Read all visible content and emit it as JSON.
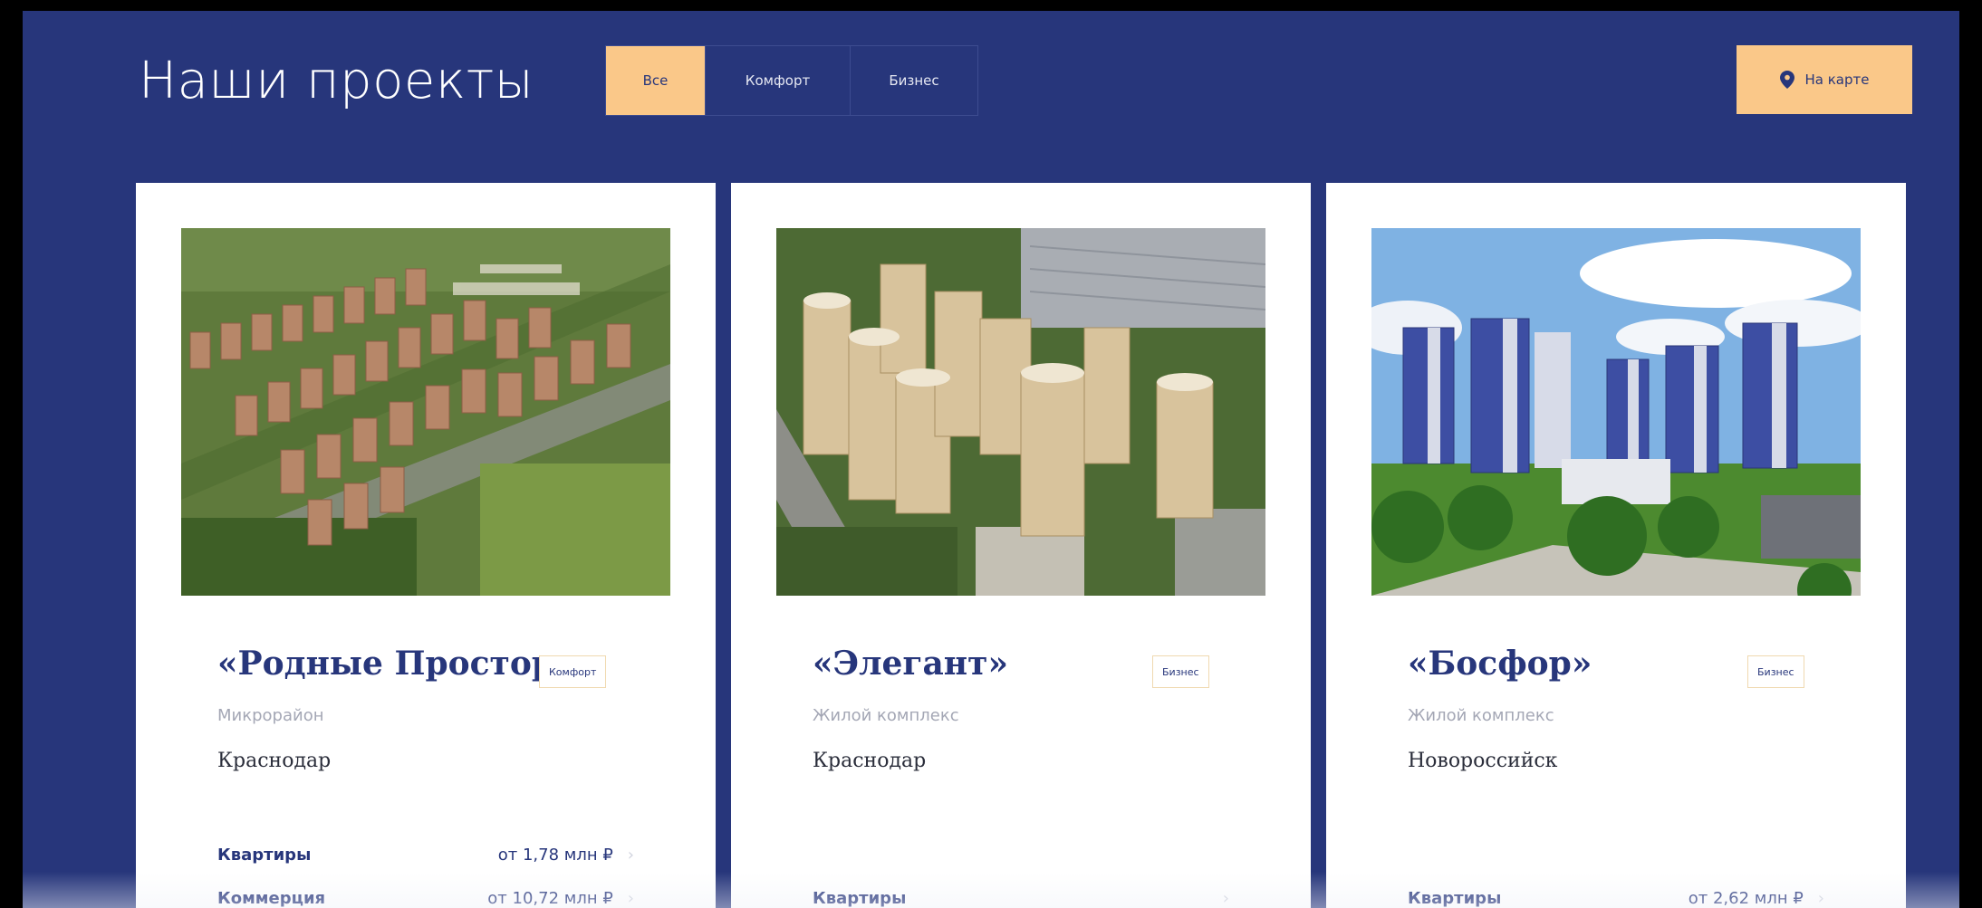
{
  "page": {
    "title": "Наши проекты"
  },
  "filters": {
    "tabs": [
      "Все",
      "Комфорт",
      "Бизнес"
    ],
    "active": "Все"
  },
  "map_button": {
    "label": "На карте",
    "icon": "map-pin-icon"
  },
  "colors": {
    "background": "#27367b",
    "accent": "#fac889",
    "card": "#ffffff",
    "text_primary": "#27367b",
    "text_muted": "#a4a7b5"
  },
  "projects": [
    {
      "name": "«Родные Просторы»",
      "badge": "Комфорт",
      "type": "Микрорайон",
      "city": "Краснодар",
      "offers": [
        {
          "label": "Квартиры",
          "price": "от 1,78 млн ₽",
          "arrow": "›"
        },
        {
          "label": "Коммерция",
          "price": "от 10,72 млн ₽",
          "arrow": "›"
        }
      ]
    },
    {
      "name": "«Элегант»",
      "badge": "Бизнес",
      "type": "Жилой комплекс",
      "city": "Краснодар",
      "offers": [
        {
          "label": "Квартиры",
          "price": "",
          "arrow": "›"
        }
      ]
    },
    {
      "name": "«Босфор»",
      "badge": "Бизнес",
      "type": "Жилой комплекс",
      "city": "Новороссийск",
      "offers": [
        {
          "label": "Квартиры",
          "price": "от 2,62 млн ₽",
          "arrow": "›"
        }
      ]
    }
  ]
}
